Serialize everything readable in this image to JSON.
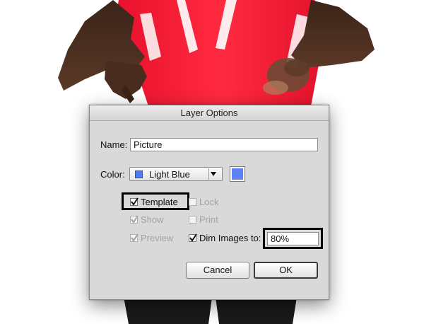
{
  "dialog": {
    "title": "Layer Options",
    "name_label": "Name:",
    "name_value": "Picture",
    "color_label": "Color:",
    "color_value": "Light Blue",
    "color_hex": "#4f7cf5",
    "options": {
      "template": {
        "label": "Template",
        "checked": true,
        "enabled": true
      },
      "lock": {
        "label": "Lock",
        "checked": false,
        "enabled": false
      },
      "show": {
        "label": "Show",
        "checked": true,
        "enabled": false
      },
      "print": {
        "label": "Print",
        "checked": false,
        "enabled": false
      },
      "preview": {
        "label": "Preview",
        "checked": true,
        "enabled": false
      },
      "dim_images": {
        "label": "Dim Images to:",
        "checked": true,
        "enabled": true
      }
    },
    "dim_value": "80%",
    "cancel_label": "Cancel",
    "ok_label": "OK"
  }
}
